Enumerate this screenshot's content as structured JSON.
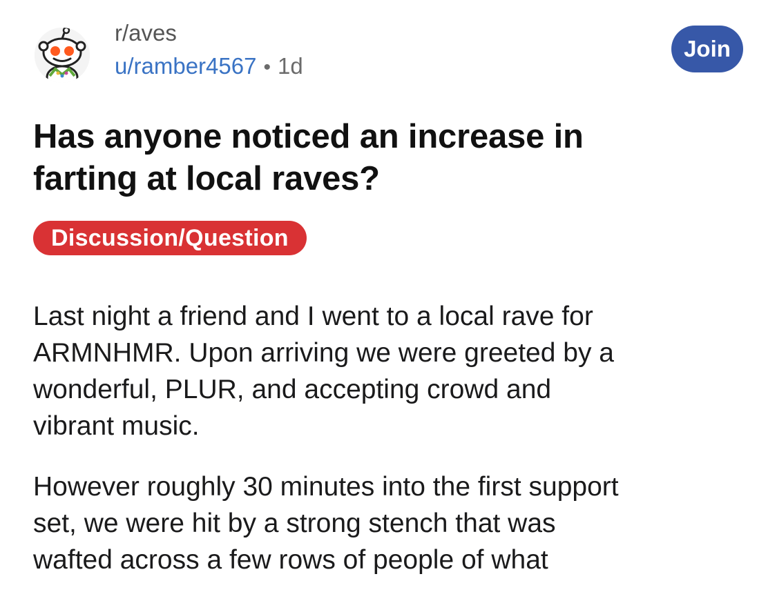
{
  "header": {
    "subreddit": "r/aves",
    "username": "u/ramber4567",
    "separator": "•",
    "age": "1d",
    "join_label": "Join"
  },
  "post": {
    "title_lines": [
      "Has anyone noticed an increase in",
      "farting at local raves?"
    ],
    "flair": "Discussion/Question",
    "flair_color": "#d93234",
    "paragraphs": [
      {
        "lines": [
          "Last night a friend and I went to a local rave for",
          "ARMNHMR. Upon arriving we were greeted by a",
          "wonderful, PLUR, and accepting crowd and",
          "vibrant music."
        ]
      },
      {
        "lines": [
          "However roughly 30 minutes into the first support",
          "set, we were hit by a strong stench that was",
          "wafted across a few rows of people of what"
        ]
      }
    ]
  },
  "colors": {
    "join_button": "#3758a8",
    "username": "#3a73c4"
  },
  "icons": {
    "avatar": "snoo-avatar-icon"
  }
}
